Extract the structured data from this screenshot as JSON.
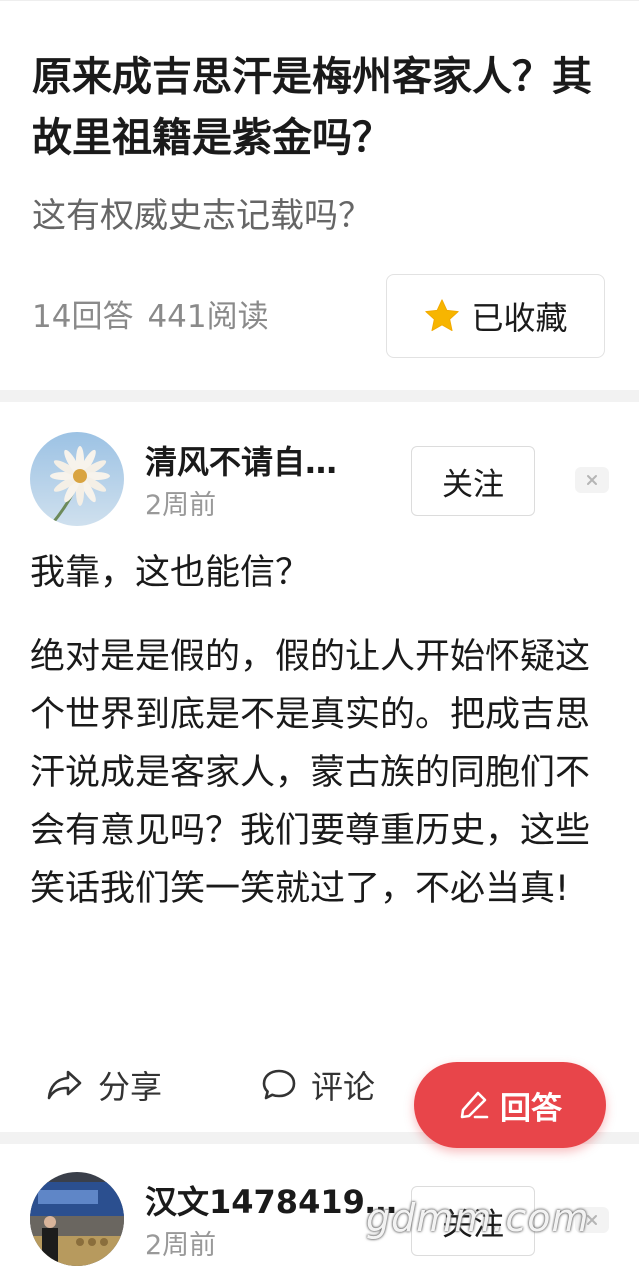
{
  "question": {
    "title": "原来成吉思汗是梅州客家人？其故里祖籍是紫金吗？",
    "subtitle": "这有权威史志记载吗？",
    "answer_count": "14回答",
    "read_count": "441阅读",
    "favorite_label": "已收藏"
  },
  "answers": [
    {
      "author": "清风不请自…",
      "time": "2周前",
      "follow_label": "关注",
      "close_icon": "×",
      "lead": "我靠，这也能信？",
      "body": "绝对是是假的，假的让人开始怀疑这个世界到底是不是真实的。把成吉思汗说成是客家人，蒙古族的同胞们不会有意见吗？我们要尊重历史，这些笑话我们笑一笑就过了，不必当真!",
      "share_label": "分享",
      "comment_label": "评论"
    },
    {
      "author": "汉文1478419…",
      "time": "2周前",
      "follow_label": "关注",
      "close_icon": "×"
    }
  ],
  "fab": {
    "label": "回答"
  },
  "watermark": "gdmm.com",
  "colors": {
    "accent": "#e8454a",
    "star": "#f7b500"
  },
  "icons": [
    "star-icon",
    "share-icon",
    "comment-icon",
    "pen-icon",
    "close-icon"
  ]
}
